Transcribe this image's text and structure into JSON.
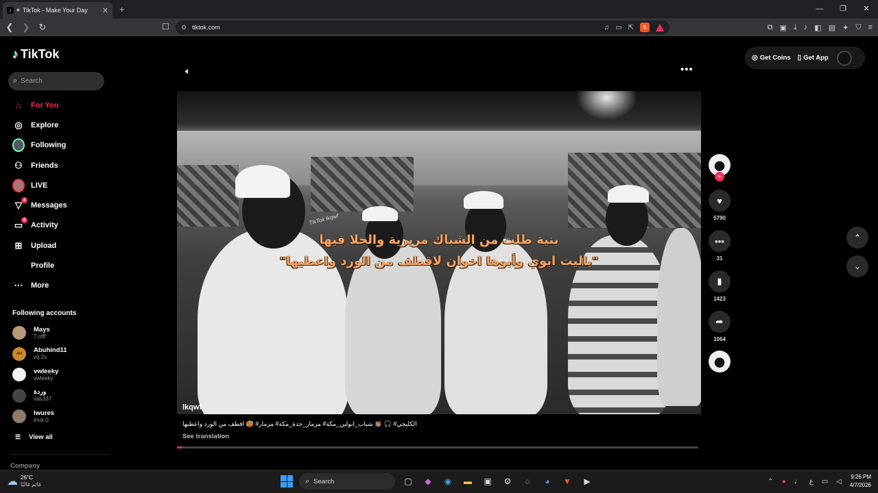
{
  "browser": {
    "tab_title": "TikTok - Make Your Day",
    "new_tab": "+",
    "url": "tiktok.com",
    "window_controls": [
      "—",
      "❐",
      "✕"
    ]
  },
  "sidebar": {
    "logo": "TikTok",
    "search_placeholder": "Search",
    "nav": [
      {
        "label": "For You",
        "icon": "home-icon",
        "active": true
      },
      {
        "label": "Explore",
        "icon": "compass-icon"
      },
      {
        "label": "Following",
        "icon": "following-avatar-icon"
      },
      {
        "label": "Friends",
        "icon": "friends-icon"
      },
      {
        "label": "LIVE",
        "icon": "live-avatar-icon"
      },
      {
        "label": "Messages",
        "icon": "messages-icon",
        "badge": "4"
      },
      {
        "label": "Activity",
        "icon": "activity-icon",
        "badge": "6"
      },
      {
        "label": "Upload",
        "icon": "upload-icon"
      },
      {
        "label": "Profile",
        "icon": "profile-icon"
      },
      {
        "label": "More",
        "icon": "more-icon"
      }
    ],
    "following_title": "Following accounts",
    "following": [
      {
        "name": "Mays",
        "handle": "7.offf"
      },
      {
        "name": "Abuhind11",
        "handle": "vq.2s",
        "avatar_text": "AH"
      },
      {
        "name": "vwleeky",
        "handle": "vwleeky"
      },
      {
        "name": "وردة",
        "handle": "oas337"
      },
      {
        "name": "lwures",
        "handle": "lmor.0"
      }
    ],
    "view_all": "View all",
    "company": "Company"
  },
  "video": {
    "caption_line1": "بنية طلت من الشباك مريرية والحلا فيها",
    "caption_line2": "\"ياليت ابوي وأبوها اخوان لاقطف من الورد واعطيها\"",
    "watermark": "TikTok lkqwf",
    "username": "lkqwf",
    "description": "الكليجي# 🎧 👏🏽 شباب_ابولين_مكة# مزمار_جدة_مكة# مزمار# 🥵 اقطف من الورد واعطيها",
    "see_translation": "See translation",
    "progress": 0.01
  },
  "actions": {
    "likes": "5790",
    "comments": "31",
    "saves": "1423",
    "shares": "1064",
    "follow_plus": "+"
  },
  "topbar": {
    "get_coins": "Get Coins",
    "get_app": "Get App"
  },
  "taskbar": {
    "temp": "26°C",
    "weather_text": "غائم غالبًا",
    "search": "Search",
    "lang": "ع",
    "time": "9:26 PM",
    "date": "4/7/2026"
  },
  "colors": {
    "accent": "#fe2c55",
    "caption": "#f0a56a"
  }
}
